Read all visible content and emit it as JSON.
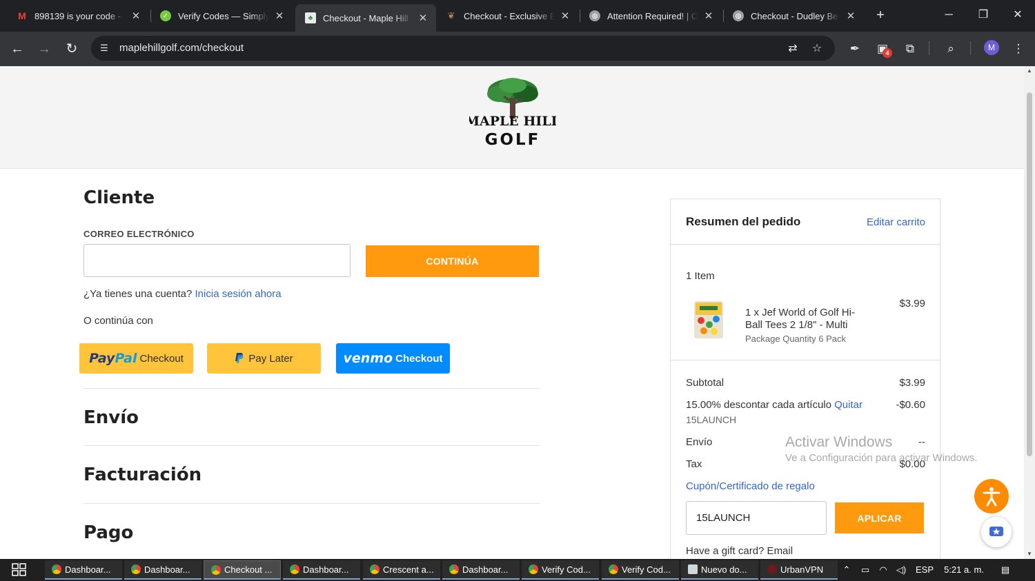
{
  "browser": {
    "tabs": [
      {
        "title": "898139 is your code -",
        "icon": "gmail-icon",
        "color": "#ea4335",
        "active": false
      },
      {
        "title": "Verify Codes — Simply",
        "icon": "verify-codes-icon",
        "color": "#7ac943",
        "active": false
      },
      {
        "title": "Checkout - Maple Hill",
        "icon": "maple-hill-icon",
        "color": "#3c8d2f",
        "active": true
      },
      {
        "title": "Checkout - Exclusive B",
        "icon": "leaf-icon",
        "color": "#b5834f",
        "active": false
      },
      {
        "title": "Attention Required! | C",
        "icon": "globe-icon",
        "color": "#9aa0a6",
        "active": false
      },
      {
        "title": "Checkout - Dudley Be",
        "icon": "globe-icon",
        "color": "#9aa0a6",
        "active": false
      }
    ],
    "url": "maplehillgolf.com/checkout",
    "extension_badge": "4",
    "profile_initial": "M"
  },
  "page": {
    "logo": {
      "top": "MAPLE HILL",
      "bottom": "GOLF"
    },
    "customer": {
      "title": "Cliente",
      "email_label": "CORREO ELECTRÓNICO",
      "email_value": "",
      "continue_button": "CONTINÚA",
      "account_question": "¿Ya tienes una cuenta?",
      "sign_in_link": "Inicia sesión ahora",
      "continue_with": "O continúa con",
      "paypal": {
        "word_a": "Pay",
        "word_b": "Pal",
        "sub": "Checkout"
      },
      "paylater": {
        "label": "Pay Later"
      },
      "venmo": {
        "word": "venmo",
        "sub": "Checkout"
      }
    },
    "sections": {
      "shipping": "Envío",
      "billing": "Facturación",
      "payment": "Pago"
    },
    "summary": {
      "title": "Resumen del pedido",
      "edit_cart": "Editar carrito",
      "items_count": "1 Item",
      "product": {
        "name": "1 x Jef World of Golf Hi-Ball Tees 2 1/8\" - Multi",
        "option": "Package Quantity 6 Pack",
        "price": "$3.99"
      },
      "subtotal": {
        "label": "Subtotal",
        "value": "$3.99"
      },
      "discount": {
        "label": "15.00% descontar cada artículo",
        "remove": "Quitar",
        "value": "-$0.60",
        "code": "15LAUNCH"
      },
      "shipping": {
        "label": "Envío",
        "value": "--"
      },
      "tax": {
        "label": "Tax",
        "value": "$0.00"
      },
      "coupon_link": "Cupón/Certificado de regalo",
      "coupon_value": "15LAUNCH",
      "apply_button": "APLICAR",
      "gift_card": "Have a gift card? Email"
    },
    "watermark": {
      "line1": "Activar Windows",
      "line2": "Ve a Configuración para activar Windows."
    }
  },
  "taskbar": {
    "items": [
      {
        "label": "Dashboar...",
        "active": false
      },
      {
        "label": "Dashboar...",
        "active": false
      },
      {
        "label": "Checkout ...",
        "active": true
      },
      {
        "label": "Dashboar...",
        "active": false
      },
      {
        "label": "Crescent a...",
        "active": false
      },
      {
        "label": "Dashboar...",
        "active": false
      },
      {
        "label": "Verify Cod...",
        "active": false
      },
      {
        "label": "Verify Cod...",
        "active": false
      },
      {
        "label": "Nuevo do...",
        "active": false
      },
      {
        "label": "UrbanVPN",
        "active": false
      }
    ],
    "language": "ESP",
    "time": "5:21 a. m."
  }
}
